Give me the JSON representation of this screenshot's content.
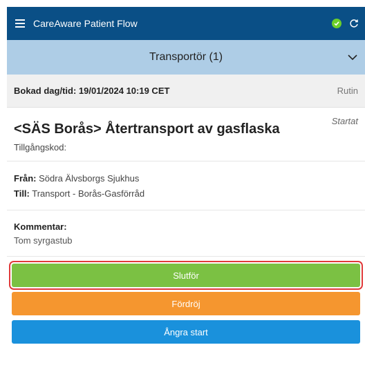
{
  "header": {
    "title": "CareAware Patient Flow",
    "status_color": "#6ccf2a",
    "bar_color": "#0a4f86"
  },
  "role": {
    "label": "Transportör (1)"
  },
  "booking": {
    "label": "Bokad dag/tid: 19/01/2024 10:19 CET",
    "priority": "Rutin"
  },
  "task": {
    "title": "<SÄS Borås> Återtransport av gasflaska",
    "status": "Startat",
    "access_code_label": "Tillgångskod:"
  },
  "route": {
    "from_label": "Från:",
    "from_value": "Södra Älvsborgs Sjukhus",
    "to_label": "Till:",
    "to_value": "Transport - Borås-Gasförråd"
  },
  "comment": {
    "label": "Kommentar:",
    "value": "Tom syrgastub"
  },
  "actions": {
    "complete": "Slutför",
    "delay": "Fördröj",
    "undo": "Ångra start"
  },
  "icons": {
    "menu": "hamburger-icon",
    "status": "check-circle-icon",
    "refresh": "refresh-icon",
    "expand": "chevron-down-icon"
  }
}
